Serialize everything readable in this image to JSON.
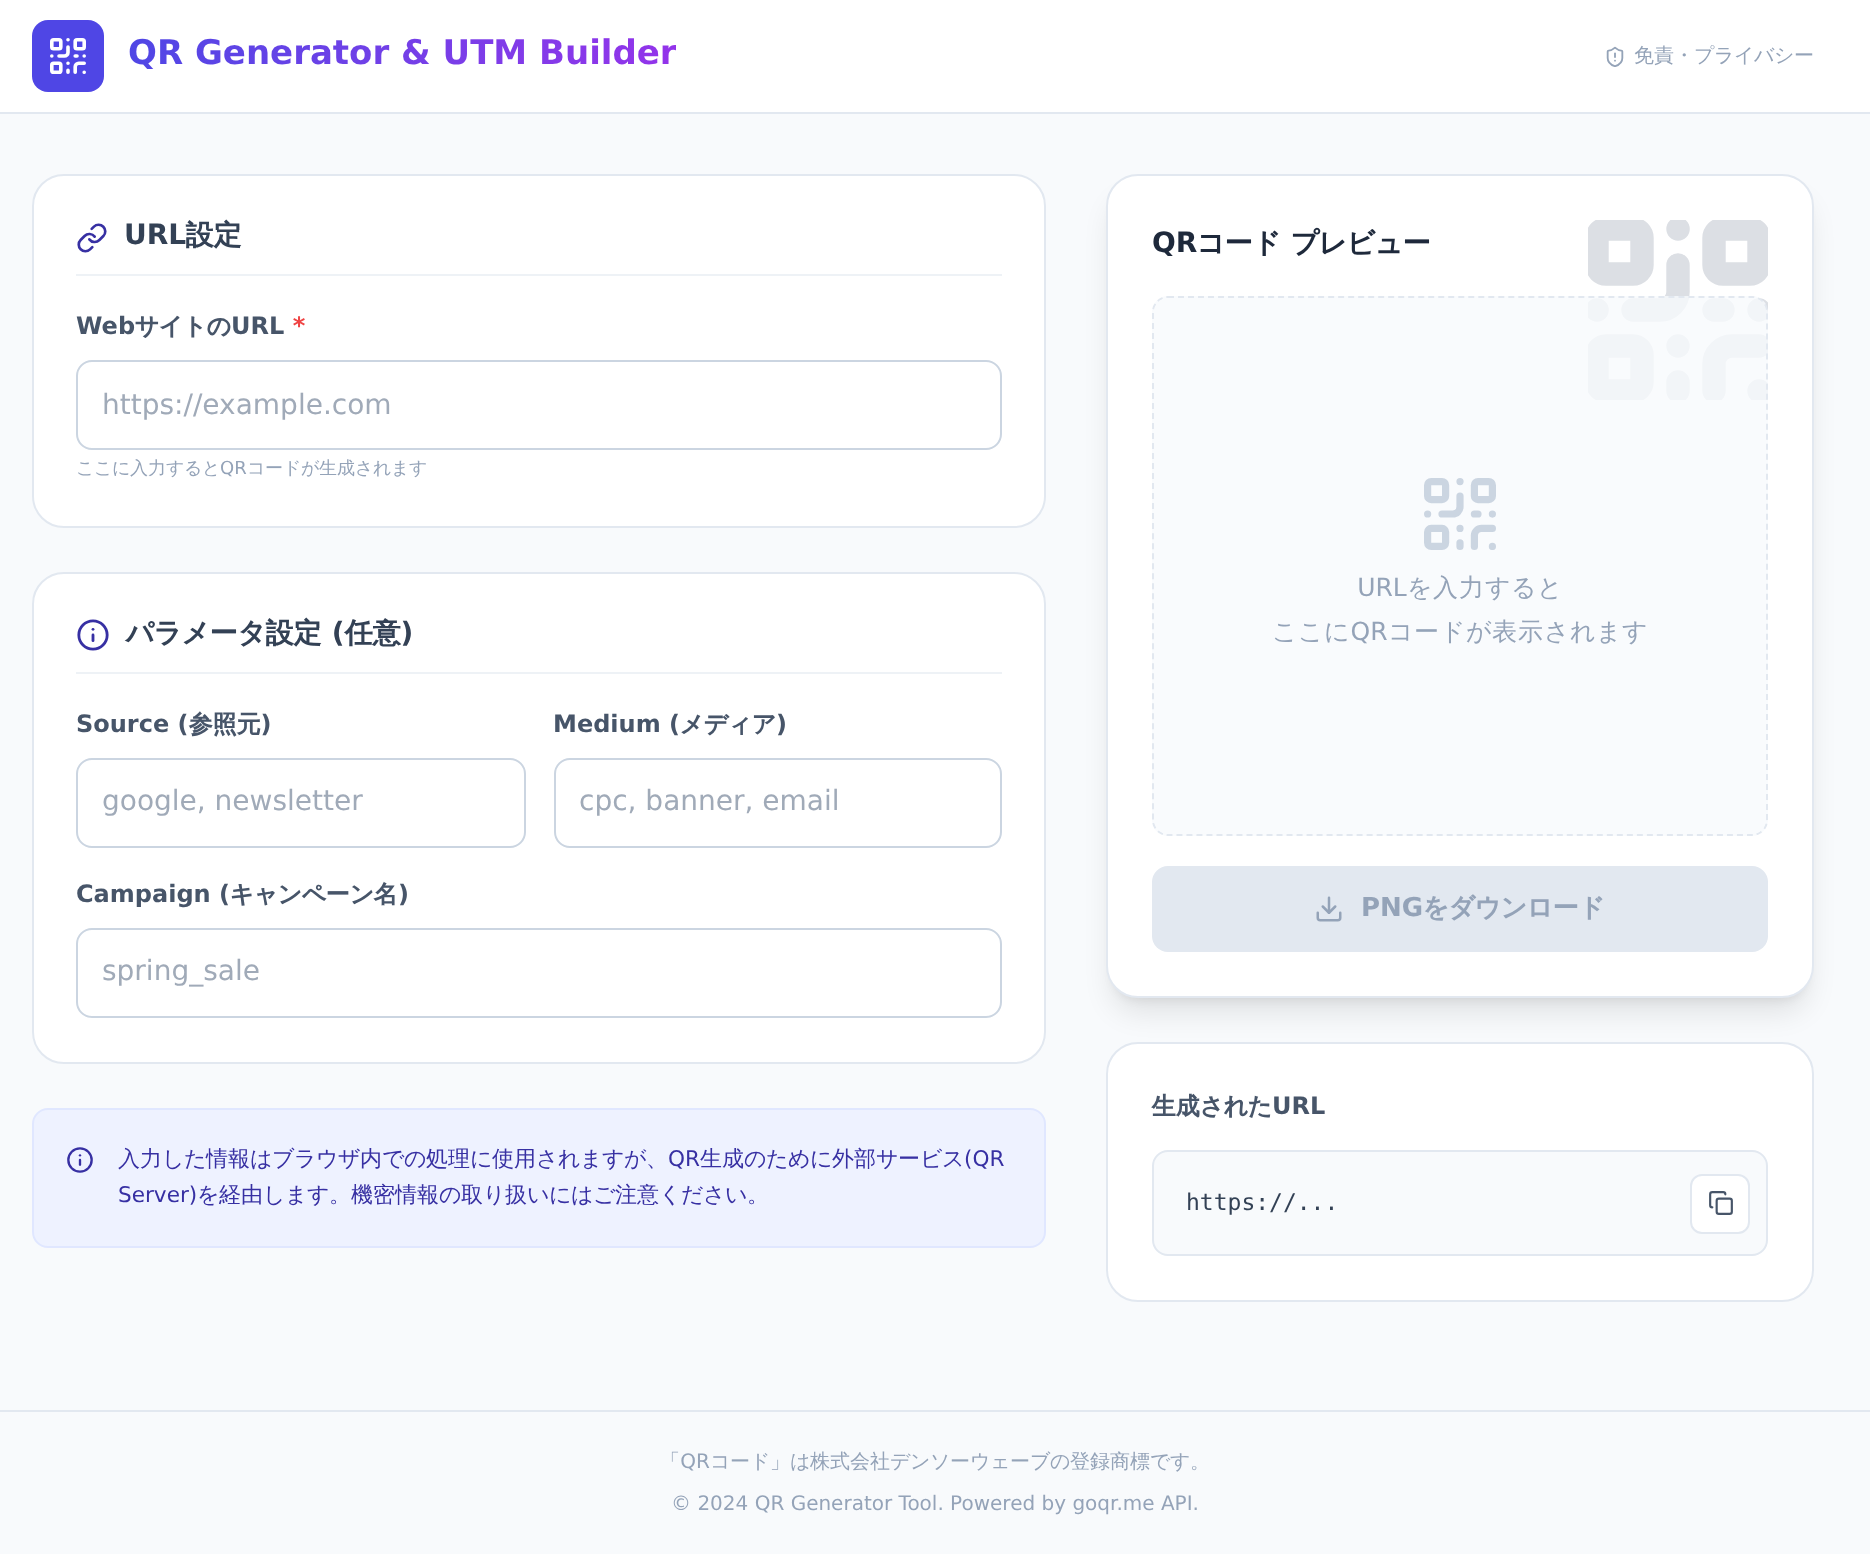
{
  "header": {
    "title": "QR Generator & UTM Builder",
    "link": "免責・プライバシー"
  },
  "url_section": {
    "title": "URL設定",
    "label": "WebサイトのURL",
    "required_mark": "*",
    "placeholder": "https://example.com",
    "hint": "ここに入力するとQRコードが生成されます"
  },
  "param_section": {
    "title": "パラメータ設定 (任意)",
    "fields": [
      {
        "label": "Source (参照元)",
        "placeholder": "google, newsletter"
      },
      {
        "label": "Medium (メディア)",
        "placeholder": "cpc, banner, email"
      },
      {
        "label": "Campaign (キャンペーン名)",
        "placeholder": "spring_sale"
      }
    ]
  },
  "notice": "入力した情報はブラウザ内での処理に使用されますが、QR生成のために外部サービス(QR Server)を経由します。機密情報の取り扱いにはご注意ください。",
  "preview": {
    "title": "QRコード プレビュー",
    "empty_lines": [
      "URLを入力すると",
      "ここにQRコードが表示されます"
    ],
    "download": {
      "label": "PNGをダウンロード",
      "disabled": true
    }
  },
  "generated": {
    "title": "生成されたURL",
    "value": "https://..."
  },
  "footer": [
    "「QRコード」は株式会社デンソーウェーブの登録商標です。",
    "© 2024 QR Generator Tool. Powered by goqr.me API."
  ]
}
